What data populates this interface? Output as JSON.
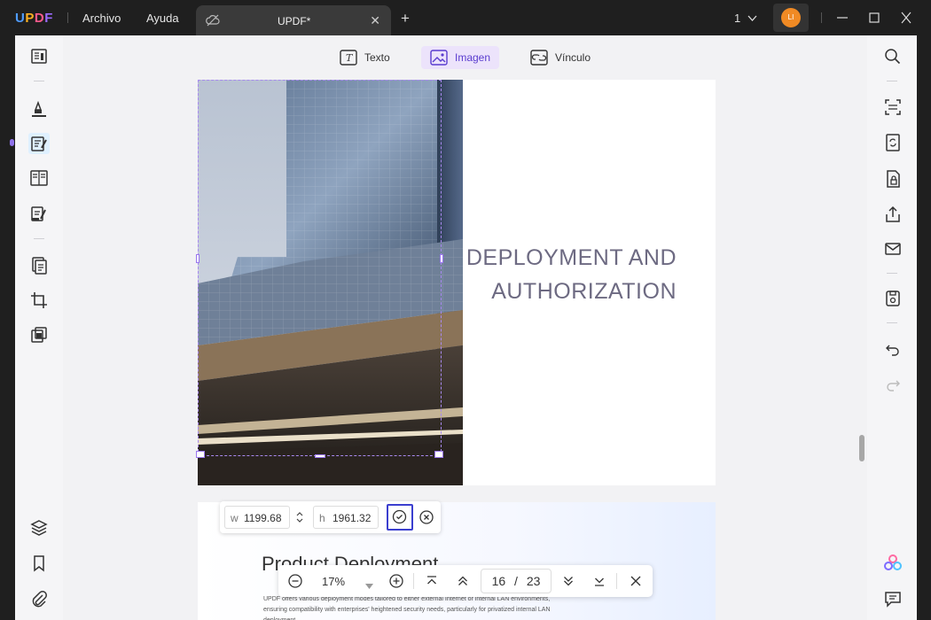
{
  "app": {
    "logo": "UPDF",
    "menu": [
      "Archivo",
      "Ayuda"
    ],
    "tab_title": "UPDF*",
    "page_count": "1",
    "user_initials": "LI"
  },
  "toolbar": {
    "text_label": "Texto",
    "image_label": "Imagen",
    "link_label": "Vínculo"
  },
  "page1": {
    "heading_line1": "DEPLOYMENT AND",
    "heading_line2": "AUTHORIZATION"
  },
  "page2": {
    "title": "Product Deployment",
    "body": "UPDF offers various deployment modes tailored to either external Internet or internal LAN environments, ensuring compatibility with enterprises' heightened security needs, particularly for privatized internal LAN deployment."
  },
  "sizebar": {
    "w_label": "w",
    "w_value": "1199.68",
    "h_label": "h",
    "h_value": "1961.32"
  },
  "zoombar": {
    "zoom": "17%",
    "current_page": "16",
    "page_separator": "/",
    "total_pages": "23"
  },
  "colors": {
    "accent": "#8f72ea",
    "active_tab_bg": "#ece3fb",
    "heading": "#6d6a82",
    "confirm_border": "#3b3fcf"
  }
}
